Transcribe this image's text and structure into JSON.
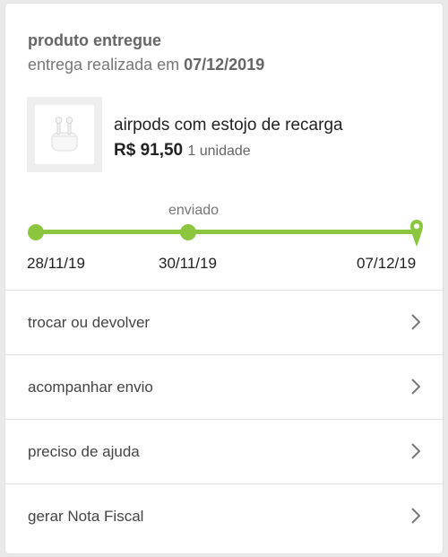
{
  "order": {
    "status": "produto entregue",
    "delivery_prefix": "entrega realizada em",
    "delivery_date": "07/12/2019"
  },
  "product": {
    "name": "airpods com estojo de recarga",
    "price": "R$ 91,50",
    "quantity": "1 unidade",
    "image_icon": "airpods-case-icon"
  },
  "tracking": {
    "step_label": "enviado",
    "dates": [
      "28/11/19",
      "30/11/19",
      "07/12/19"
    ],
    "accent_color": "#8cc63f"
  },
  "actions": [
    {
      "label": "trocar ou devolver",
      "icon": "chevron-right-icon"
    },
    {
      "label": "acompanhar envio",
      "icon": "chevron-right-icon"
    },
    {
      "label": "preciso de ajuda",
      "icon": "chevron-right-icon"
    },
    {
      "label": "gerar Nota Fiscal",
      "icon": "chevron-right-icon"
    }
  ]
}
